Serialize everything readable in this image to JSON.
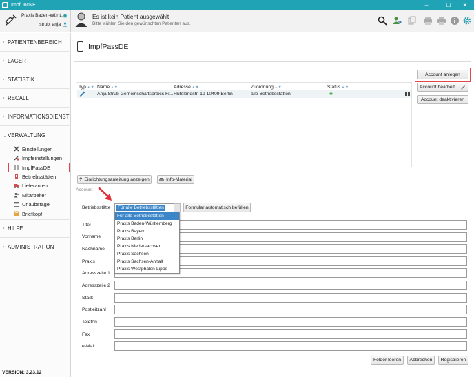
{
  "window": {
    "title": "ImpfDocNE",
    "minimize": "–",
    "maximize": "☐",
    "close": "✕"
  },
  "practice": {
    "name": "Praxis Baden-Württ...",
    "user": "strub, anja"
  },
  "patient": {
    "title": "Es ist kein Patient ausgewählt",
    "subtitle": "Bitte wählen Sie den gewünschten Patienten aus."
  },
  "toolbar": {
    "icons": [
      "search-icon",
      "transfer-icon",
      "documents-icon",
      "print-icon",
      "print-alt-icon",
      "info-icon",
      "gear-icon"
    ]
  },
  "sidebar": {
    "sections": [
      {
        "label": "PATIENTENBEREICH",
        "chev": "›"
      },
      {
        "label": "LAGER",
        "chev": "›"
      },
      {
        "label": "STATISTIK",
        "chev": "›"
      },
      {
        "label": "RECALL",
        "chev": "›"
      },
      {
        "label": "INFORMATIONSDIENST",
        "chev": "›"
      },
      {
        "label": "VERWALTUNG",
        "chev": "⌄"
      },
      {
        "label": "HILFE",
        "chev": "›"
      },
      {
        "label": "ADMINISTRATION",
        "chev": "›"
      }
    ],
    "verwaltung_items": [
      {
        "label": "Einstellungen",
        "icon": "tools-icon"
      },
      {
        "label": "Impfeinstellungen",
        "icon": "syringe-settings-icon"
      },
      {
        "label": "ImpfPassDE",
        "icon": "phone-icon"
      },
      {
        "label": "Betriebsstätten",
        "icon": "building-icon"
      },
      {
        "label": "Lieferanten",
        "icon": "truck-icon"
      },
      {
        "label": "Mitarbeiter",
        "icon": "people-icon"
      },
      {
        "label": "Urlaubstage",
        "icon": "calendar-icon"
      },
      {
        "label": "Briefkopf",
        "icon": "letterhead-icon"
      }
    ],
    "version": "VERSION: 3.23.12"
  },
  "page": {
    "title": "ImpfPassDE"
  },
  "table": {
    "columns": [
      "Typ",
      "Name",
      "Adresse",
      "Zuordnung",
      "Status"
    ],
    "rows": [
      {
        "name": "Anja Strub Gemeinschaftspraxis Fr...",
        "address": "Hufelandstr. 19 10409 Berlin",
        "assignment": "alle Betriebsstätten"
      }
    ]
  },
  "actions": {
    "create": "Account anlegen",
    "edit": "Account bearbeit...",
    "deactivate": "Account deaktivieren"
  },
  "subtabs": {
    "setup_guide": "Einrichtungsanleitung anzeigen",
    "info_material": "Info-Material"
  },
  "account": {
    "section_label": "Account",
    "site_label": "Betriebsstätte",
    "site_selected": "Für alle Betriebsstätten",
    "autofill": "Formular automatisch befüllen",
    "site_options": [
      "Für alle Betriebsstätten",
      "Praxis Baden-Württemberg",
      "Praxis Bayern",
      "Praxis Berlin",
      "Praxis Niedersachsen",
      "Praxis Sachsen",
      "Praxis Sachsen-Anhalt",
      "Praxis Westphalen-Lippe"
    ],
    "fields": [
      {
        "label": "Titel",
        "value": ""
      },
      {
        "label": "Vorname",
        "value": ""
      },
      {
        "label": "Nachname",
        "value": ""
      },
      {
        "label": "Praxis",
        "value": ""
      },
      {
        "label": "Adresszeile 1",
        "value": ""
      },
      {
        "label": "Adresszeile 2",
        "value": ""
      },
      {
        "label": "Stadt",
        "value": ""
      },
      {
        "label": "Postleitzahl",
        "value": ""
      },
      {
        "label": "Telefon",
        "value": ""
      },
      {
        "label": "Fax",
        "value": ""
      },
      {
        "label": "e-Mail",
        "value": ""
      }
    ],
    "clear": "Felder leeren",
    "cancel": "Abbrechen",
    "register": "Registrieren"
  },
  "colors": {
    "titlebar": "#20a3b4",
    "highlight": "#e0474c",
    "selection": "#3a86c9",
    "status_dot": "#4caf50"
  }
}
